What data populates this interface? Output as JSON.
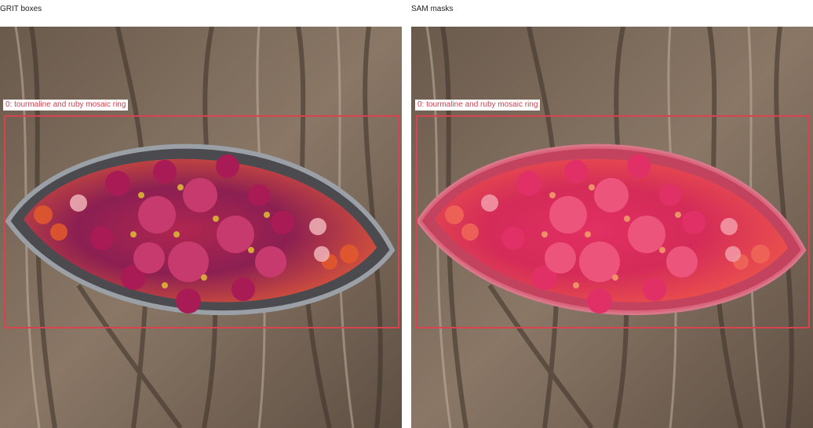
{
  "panels": [
    {
      "title": "GRIT boxes",
      "label": "0: tourmaline and ruby mosaic ring"
    },
    {
      "title": "SAM masks",
      "label": "0: tourmaline and ruby mosaic ring"
    }
  ],
  "colors": {
    "box": "#d9434f",
    "mask": "#e2304f"
  }
}
